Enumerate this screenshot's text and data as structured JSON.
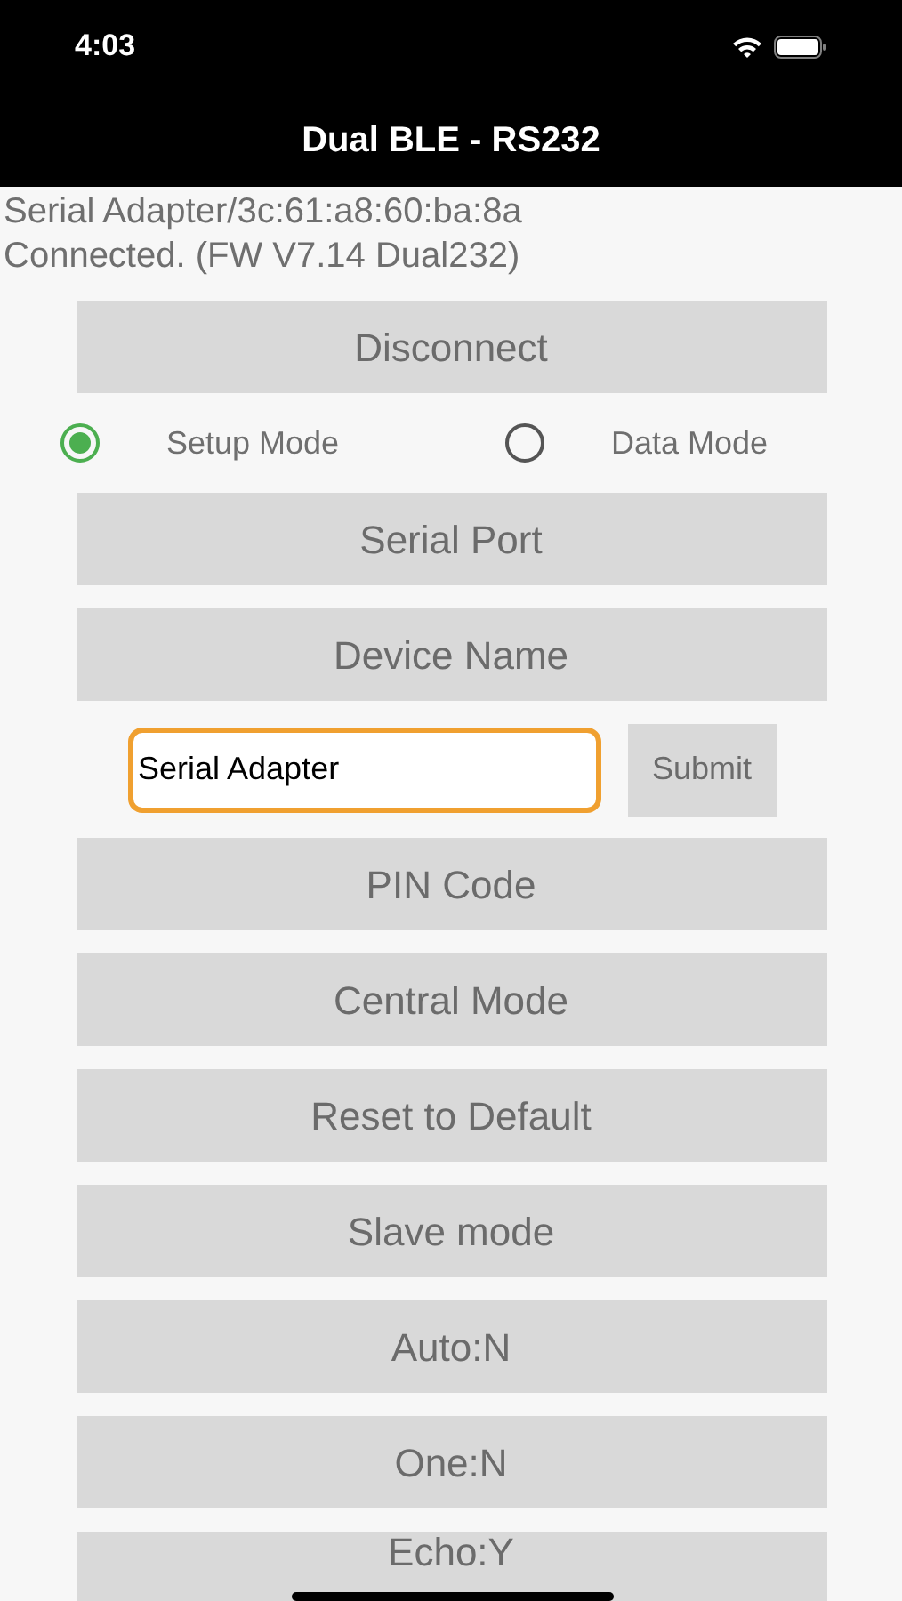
{
  "status_bar": {
    "time": "4:03"
  },
  "title_bar": {
    "title": "Dual BLE - RS232"
  },
  "connection_info": {
    "device": "Serial Adapter/3c:61:a8:60:ba:8a",
    "status": "Connected. (FW V7.14 Dual232)"
  },
  "disconnect_button": "Disconnect",
  "modes": [
    {
      "label": "Setup Mode",
      "selected": true
    },
    {
      "label": "Data Mode",
      "selected": false
    }
  ],
  "items": [
    {
      "kind": "button",
      "label": "Serial Port"
    },
    {
      "kind": "button",
      "label": "Device Name"
    },
    {
      "kind": "input",
      "value": "Serial Adapter",
      "focused": true,
      "button": "Submit"
    },
    {
      "kind": "button",
      "label": "PIN Code"
    },
    {
      "kind": "button",
      "label": "Central Mode"
    },
    {
      "kind": "button",
      "label": "Reset to Default"
    },
    {
      "kind": "button",
      "label": "Slave mode"
    },
    {
      "kind": "button",
      "label": "Auto:N"
    },
    {
      "kind": "button",
      "label": "One:N"
    },
    {
      "kind": "button",
      "label": "Echo:Y"
    }
  ]
}
